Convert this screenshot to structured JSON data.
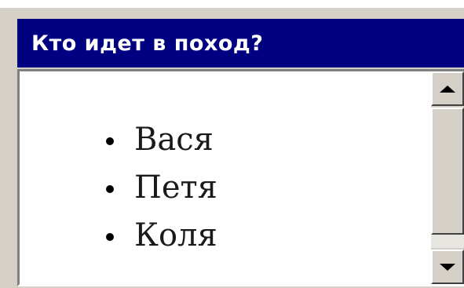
{
  "window": {
    "title": "Кто идет в поход?"
  },
  "list": {
    "items": [
      {
        "label": "Вася"
      },
      {
        "label": "Петя"
      },
      {
        "label": "Коля"
      }
    ]
  },
  "icons": {
    "bullet": "bullet-dot",
    "scroll_up": "arrow-up",
    "scroll_down": "arrow-down"
  },
  "colors": {
    "title_bar": "#000080",
    "title_text": "#ffffff",
    "chrome": "#d4d0c8",
    "content_bg": "#ffffff"
  }
}
